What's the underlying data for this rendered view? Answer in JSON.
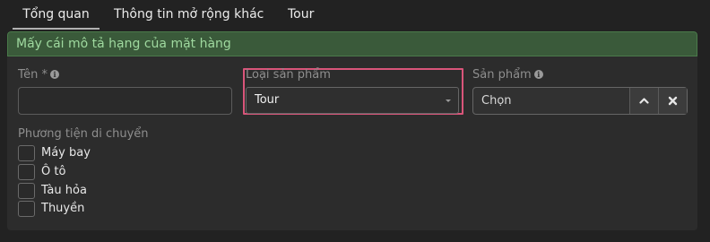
{
  "tabs": [
    {
      "label": "Tổng quan",
      "active": true
    },
    {
      "label": "Thông tin mở rộng khác",
      "active": false
    },
    {
      "label": "Tour",
      "active": false
    }
  ],
  "panel": {
    "header": "Mấy cái mô tả hạng của mặt hàng"
  },
  "fields": {
    "name": {
      "label": "Tên *",
      "value": "",
      "info_icon": "info-circle-icon"
    },
    "product_type": {
      "label": "Loại sản phẩm",
      "value": "Tour"
    },
    "product": {
      "label": "Sản phẩm",
      "value": "Chọn",
      "info_icon": "info-circle-icon"
    }
  },
  "transport": {
    "label": "Phương tiện di chuyển",
    "options": [
      {
        "label": "Máy bay",
        "checked": false
      },
      {
        "label": "Ô tô",
        "checked": false
      },
      {
        "label": "Tàu hỏa",
        "checked": false
      },
      {
        "label": "Thuyền",
        "checked": false
      }
    ]
  },
  "colors": {
    "background": "#222222",
    "panel": "#2c2c2c",
    "header_bg": "#3a5a3a",
    "header_text": "#9fd99f",
    "highlight": "#d9557a"
  }
}
